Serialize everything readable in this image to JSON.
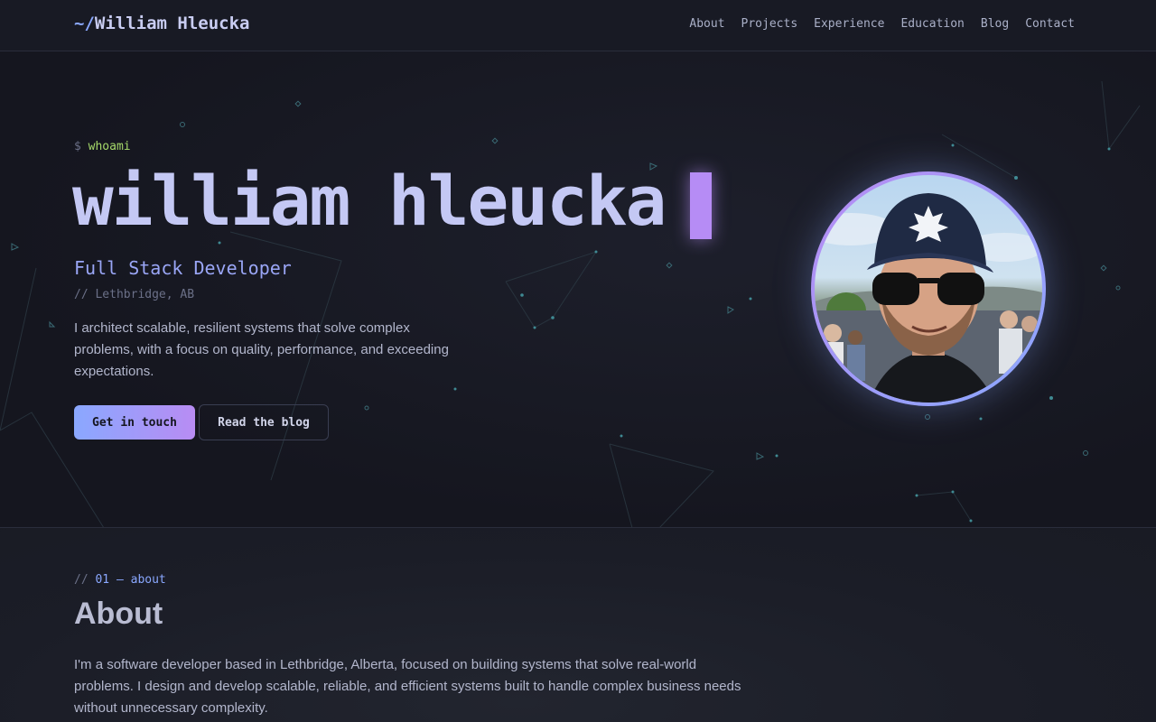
{
  "brand": {
    "prefix": "~/",
    "name": "William Hleucka"
  },
  "nav": {
    "links": [
      "About",
      "Projects",
      "Experience",
      "Education",
      "Blog",
      "Contact"
    ]
  },
  "hero": {
    "prompt_symbol": "$",
    "prompt_command": "whoami",
    "name": "william hleucka",
    "role": "Full Stack Developer",
    "location": "// Lethbridge, AB",
    "intro": "I architect scalable, resilient systems that solve complex problems, with a focus on quality, performance, and exceeding expectations.",
    "primary_button": "Get in touch",
    "secondary_button": "Read the blog"
  },
  "about": {
    "tag_slashes": "//",
    "tag_label": "01 — about",
    "title": "About",
    "text": "I'm a software developer based in Lethbridge, Alberta, focused on building systems that solve real-world problems. I design and develop scalable, reliable, and efficient systems built to handle complex business needs without unnecessary complexity."
  },
  "colors": {
    "accent_blue": "#8aa8ff",
    "accent_purple": "#b88cf3",
    "prompt_green": "#a6d96a",
    "background": "#15161f"
  },
  "icons": {
    "avatar": "profile-photo"
  }
}
